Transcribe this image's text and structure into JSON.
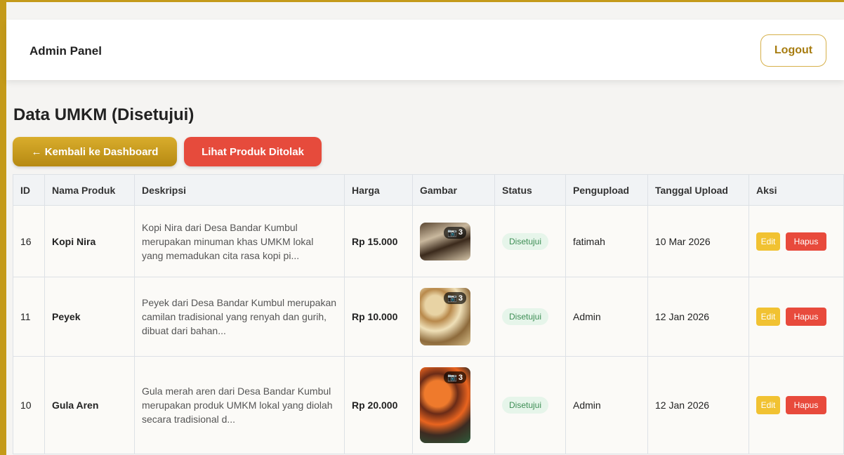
{
  "navbar": {
    "brand": "Admin Panel",
    "logout_label": "Logout"
  },
  "page": {
    "title": "Data UMKM (Disetujui)",
    "back_label": "← Kembali ke Dashboard",
    "rejected_label": "Lihat Produk Ditolak"
  },
  "table": {
    "headers": [
      "ID",
      "Nama Produk",
      "Deskripsi",
      "Harga",
      "Gambar",
      "Status",
      "Pengupload",
      "Tanggal Upload",
      "Aksi"
    ],
    "rows": [
      {
        "id": "16",
        "name": "Kopi Nira",
        "description": "Kopi Nira dari Desa Bandar Kumbul merupakan minuman khas UMKM lokal yang memadukan cita rasa kopi pi...",
        "price": "Rp 15.000",
        "image_count": "3",
        "status": "Disetujui",
        "uploader": "fatimah",
        "date": "10 Mar 2026",
        "edit_label": "Edit",
        "delete_label": "Hapus"
      },
      {
        "id": "11",
        "name": "Peyek",
        "description": "Peyek dari Desa Bandar Kumbul merupakan camilan tradisional yang renyah dan gurih, dibuat dari bahan...",
        "price": "Rp 10.000",
        "image_count": "3",
        "status": "Disetujui",
        "uploader": "Admin",
        "date": "12 Jan 2026",
        "edit_label": "Edit",
        "delete_label": "Hapus"
      },
      {
        "id": "10",
        "name": "Gula Aren",
        "description": "Gula merah aren dari Desa Bandar Kumbul merupakan produk UMKM lokal yang diolah secara tradisional d...",
        "price": "Rp 20.000",
        "image_count": "3",
        "status": "Disetujui",
        "uploader": "Admin",
        "date": "12 Jan 2026",
        "edit_label": "Edit",
        "delete_label": "Hapus"
      }
    ]
  },
  "colors": {
    "frame": "#c49a1a",
    "primary_gold": "#c49a1a",
    "danger": "#e64b3c",
    "warning": "#f1c232",
    "success_bg": "#e6f5ea",
    "success_text": "#3e8e55"
  },
  "icons": {
    "image_count": "camera-icon"
  }
}
